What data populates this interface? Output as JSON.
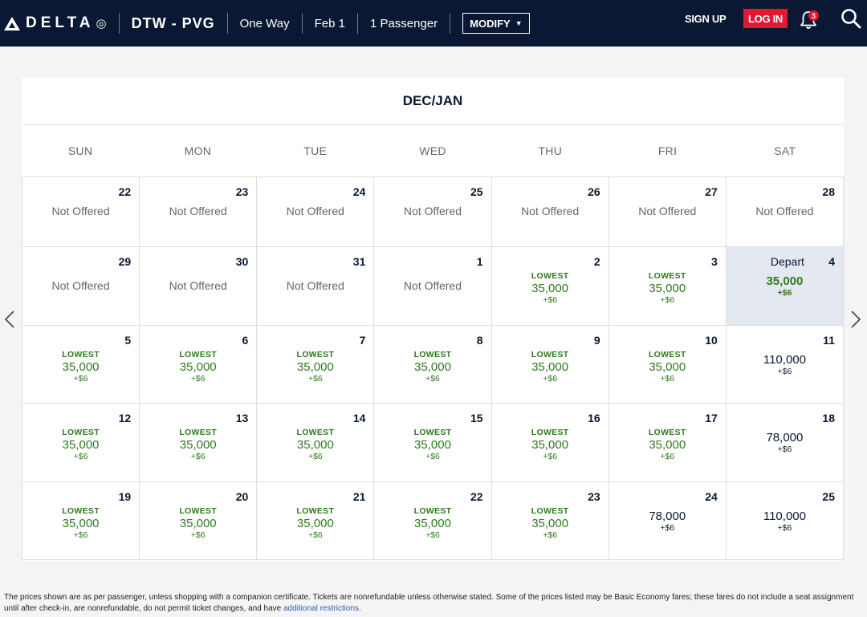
{
  "header": {
    "logo_text": "DELTA",
    "route": "DTW - PVG",
    "trip_type": "One Way",
    "date": "Feb 1",
    "passengers": "1 Passenger",
    "modify_label": "MODIFY",
    "signup_label": "SIGN UP",
    "login_label": "LOG IN",
    "notification_count": "3",
    "icons": [
      "delta-widget-logo-icon",
      "caret-down-icon",
      "bell-icon",
      "search-icon",
      "chevron-left-icon",
      "chevron-right-icon"
    ]
  },
  "calendar": {
    "month_title": "DEC/JAN",
    "weekdays": [
      "SUN",
      "MON",
      "TUE",
      "WED",
      "THU",
      "FRI",
      "SAT"
    ],
    "weeks": [
      [
        {
          "day": "22",
          "status": "Not Offered"
        },
        {
          "day": "23",
          "status": "Not Offered"
        },
        {
          "day": "24",
          "status": "Not Offered"
        },
        {
          "day": "25",
          "status": "Not Offered"
        },
        {
          "day": "26",
          "status": "Not Offered"
        },
        {
          "day": "27",
          "status": "Not Offered"
        },
        {
          "day": "28",
          "status": "Not Offered"
        }
      ],
      [
        {
          "day": "29",
          "status": "Not Offered"
        },
        {
          "day": "30",
          "status": "Not Offered"
        },
        {
          "day": "31",
          "status": "Not Offered"
        },
        {
          "day": "1",
          "status": "Not Offered"
        },
        {
          "day": "2",
          "lowest": "LOWEST",
          "miles": "35,000",
          "tax": "+$6"
        },
        {
          "day": "3",
          "lowest": "LOWEST",
          "miles": "35,000",
          "tax": "+$6"
        },
        {
          "day": "4",
          "depart": "Depart",
          "miles": "35,000",
          "tax": "+$6",
          "selected": true
        }
      ],
      [
        {
          "day": "5",
          "lowest": "LOWEST",
          "miles": "35,000",
          "tax": "+$6"
        },
        {
          "day": "6",
          "lowest": "LOWEST",
          "miles": "35,000",
          "tax": "+$6"
        },
        {
          "day": "7",
          "lowest": "LOWEST",
          "miles": "35,000",
          "tax": "+$6"
        },
        {
          "day": "8",
          "lowest": "LOWEST",
          "miles": "35,000",
          "tax": "+$6"
        },
        {
          "day": "9",
          "lowest": "LOWEST",
          "miles": "35,000",
          "tax": "+$6"
        },
        {
          "day": "10",
          "lowest": "LOWEST",
          "miles": "35,000",
          "tax": "+$6"
        },
        {
          "day": "11",
          "miles": "110,000",
          "tax": "+$6"
        }
      ],
      [
        {
          "day": "12",
          "lowest": "LOWEST",
          "miles": "35,000",
          "tax": "+$6"
        },
        {
          "day": "13",
          "lowest": "LOWEST",
          "miles": "35,000",
          "tax": "+$6"
        },
        {
          "day": "14",
          "lowest": "LOWEST",
          "miles": "35,000",
          "tax": "+$6"
        },
        {
          "day": "15",
          "lowest": "LOWEST",
          "miles": "35,000",
          "tax": "+$6"
        },
        {
          "day": "16",
          "lowest": "LOWEST",
          "miles": "35,000",
          "tax": "+$6"
        },
        {
          "day": "17",
          "lowest": "LOWEST",
          "miles": "35,000",
          "tax": "+$6"
        },
        {
          "day": "18",
          "miles": "78,000",
          "tax": "+$6"
        }
      ],
      [
        {
          "day": "19",
          "lowest": "LOWEST",
          "miles": "35,000",
          "tax": "+$6"
        },
        {
          "day": "20",
          "lowest": "LOWEST",
          "miles": "35,000",
          "tax": "+$6"
        },
        {
          "day": "21",
          "lowest": "LOWEST",
          "miles": "35,000",
          "tax": "+$6"
        },
        {
          "day": "22",
          "lowest": "LOWEST",
          "miles": "35,000",
          "tax": "+$6"
        },
        {
          "day": "23",
          "lowest": "LOWEST",
          "miles": "35,000",
          "tax": "+$6"
        },
        {
          "day": "24",
          "miles": "78,000",
          "tax": "+$6"
        },
        {
          "day": "25",
          "miles": "110,000",
          "tax": "+$6"
        }
      ]
    ]
  },
  "footer": {
    "disclaimer": "The prices shown are as per passenger, unless shopping with a companion certificate. Tickets are nonrefundable unless otherwise stated. Some of the prices listed may be Basic Economy fares; these fares do not include a seat assignment until after check-in, are nonrefundable, do not permit ticket changes, and have",
    "link_label": "additional restrictions",
    "end": "."
  },
  "colors": {
    "header_bg": "#0a1833",
    "login_red": "#e01933",
    "fare_green": "#2e7a1e",
    "selected_bg": "#e3e8f1",
    "navy_text": "#0a1833"
  }
}
